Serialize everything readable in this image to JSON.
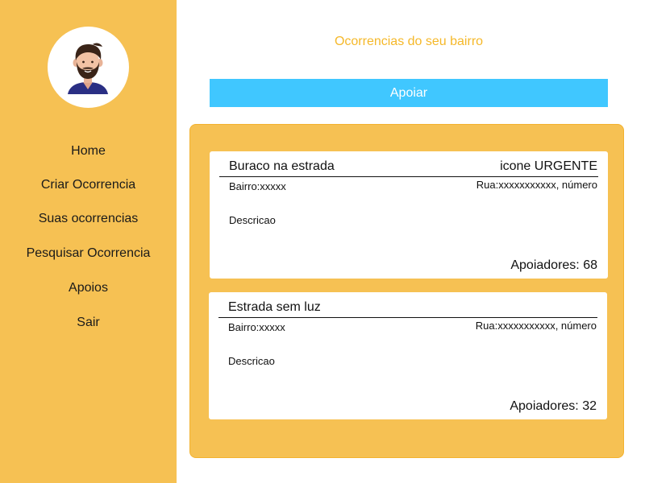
{
  "sidebar": {
    "avatar_icon": "user-avatar-icon",
    "items": [
      {
        "label": "Home"
      },
      {
        "label": "Criar Ocorrencia"
      },
      {
        "label": "Suas ocorrencias"
      },
      {
        "label": "Pesquisar Ocorrencia"
      },
      {
        "label": "Apoios"
      },
      {
        "label": "Sair"
      }
    ]
  },
  "main": {
    "title": "Ocorrencias do seu bairro",
    "apoiar_label": "Apoiar",
    "occurrences": [
      {
        "title": "Buraco na estrada",
        "badge": "icone URGENTE",
        "bairro": "Bairro:xxxxx",
        "rua": "Rua:xxxxxxxxxxx, número",
        "descricao": "Descricao",
        "apoiadores": "Apoiadores: 68"
      },
      {
        "title": "Estrada sem luz",
        "bairro": "Bairro:xxxxx",
        "rua": "Rua:xxxxxxxxxxx, número",
        "descricao": "Descricao",
        "apoiadores": "Apoiadores: 32"
      }
    ]
  },
  "colors": {
    "sidebar_bg": "#F6C153",
    "panel_bg": "#F6C153",
    "title_color": "#F5B829",
    "button_bg": "#40C7FF",
    "card_bg": "#FFFFFF"
  }
}
